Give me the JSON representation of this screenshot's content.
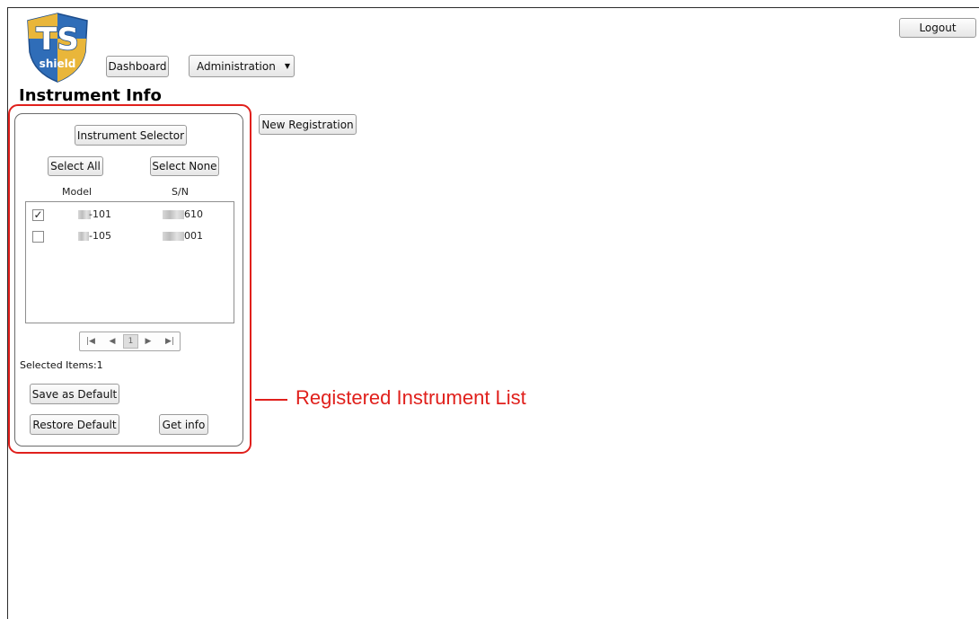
{
  "header": {
    "logo_text": "TS",
    "logo_sub": "shield",
    "logout_label": "Logout",
    "nav": {
      "dashboard_label": "Dashboard",
      "administration_label": "Administration",
      "administration_arrow": "▼"
    }
  },
  "page_title": "Instrument Info",
  "actions": {
    "new_registration_label": "New Registration"
  },
  "instrument_panel": {
    "instrument_selector_label": "Instrument Selector",
    "select_all_label": "Select All",
    "select_none_label": "Select None",
    "columns": {
      "model": "Model",
      "serial": "S/N"
    },
    "rows": [
      {
        "checked": true,
        "model_suffix": "-101",
        "serial_suffix": "610"
      },
      {
        "checked": false,
        "model_suffix": "-105",
        "serial_suffix": "001"
      }
    ],
    "pager": {
      "first": "|◀",
      "prev": "◀",
      "current_page": "1",
      "next": "▶",
      "last": "▶|"
    },
    "selected_items_text": "Selected Items:1",
    "save_default_label": "Save as Default",
    "restore_default_label": "Restore Default",
    "get_info_label": "Get info"
  },
  "annotation": {
    "label": "Registered Instrument List",
    "color": "#e0201c"
  },
  "colors": {
    "logo_blue": "#1e5aa8",
    "logo_gold": "#e9b63a",
    "accent_red": "#e0201c"
  }
}
